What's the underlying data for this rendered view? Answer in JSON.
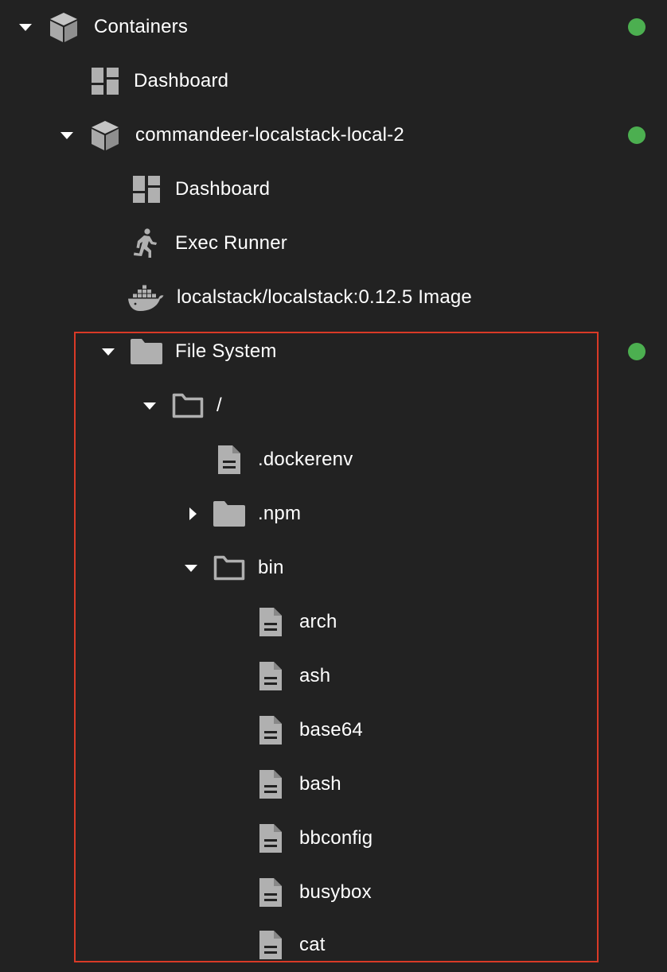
{
  "colors": {
    "status_ok": "#4caf50",
    "icon_gray": "#b0b0b0",
    "highlight": "#d93a27"
  },
  "tree": {
    "containers": {
      "label": "Containers",
      "icon": "cube-icon",
      "expanded": true,
      "status": "running"
    },
    "containers_dashboard": {
      "label": "Dashboard",
      "icon": "dashboard-icon"
    },
    "container": {
      "label": "commandeer-localstack-local-2",
      "icon": "cube-icon",
      "expanded": true,
      "status": "running"
    },
    "container_dashboard": {
      "label": "Dashboard",
      "icon": "dashboard-icon"
    },
    "exec_runner": {
      "label": "Exec Runner",
      "icon": "running-person-icon"
    },
    "image": {
      "label": "localstack/localstack:0.12.5 Image",
      "icon": "docker-whale-icon"
    },
    "file_system": {
      "label": "File System",
      "icon": "folder-filled-icon",
      "expanded": true,
      "status": "running"
    },
    "root": {
      "label": "/",
      "icon": "folder-open-icon",
      "expanded": true
    },
    "dockerenv": {
      "label": ".dockerenv",
      "icon": "file-icon"
    },
    "npm": {
      "label": ".npm",
      "icon": "folder-filled-icon",
      "expanded": false
    },
    "bin": {
      "label": "bin",
      "icon": "folder-open-icon",
      "expanded": true
    },
    "bin_files": [
      {
        "label": "arch",
        "icon": "file-icon"
      },
      {
        "label": "ash",
        "icon": "file-icon"
      },
      {
        "label": "base64",
        "icon": "file-icon"
      },
      {
        "label": "bash",
        "icon": "file-icon"
      },
      {
        "label": "bbconfig",
        "icon": "file-icon"
      },
      {
        "label": "busybox",
        "icon": "file-icon"
      },
      {
        "label": "cat",
        "icon": "file-icon"
      }
    ]
  }
}
